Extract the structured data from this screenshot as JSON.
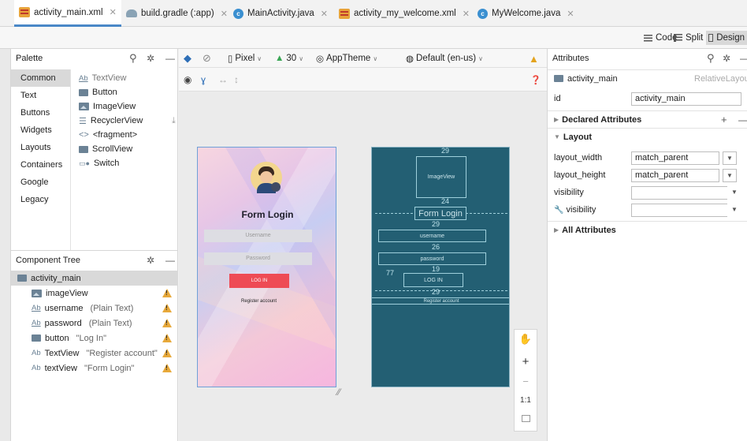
{
  "tabs": [
    {
      "label": "activity_main.xml",
      "icon": "xml-icon"
    },
    {
      "label": "build.gradle (:app)",
      "icon": "gradle-icon"
    },
    {
      "label": "MainActivity.java",
      "icon": "class-icon"
    },
    {
      "label": "activity_my_welcome.xml",
      "icon": "xml-icon"
    },
    {
      "label": "MyWelcome.java",
      "icon": "class-icon"
    }
  ],
  "modes": {
    "code": "Code",
    "split": "Split",
    "design": "Design"
  },
  "palette": {
    "title": "Palette",
    "categories": [
      "Common",
      "Text",
      "Buttons",
      "Widgets",
      "Layouts",
      "Containers",
      "Google",
      "Legacy"
    ],
    "items": [
      "TextView",
      "Button",
      "ImageView",
      "RecyclerView",
      "<fragment>",
      "ScrollView",
      "Switch"
    ]
  },
  "component_tree": {
    "title": "Component Tree",
    "root": "activity_main",
    "children": [
      {
        "name": "imageView",
        "hint": ""
      },
      {
        "name": "username",
        "hint": "(Plain Text)"
      },
      {
        "name": "password",
        "hint": "(Plain Text)"
      },
      {
        "name": "button",
        "hint": "\"Log In\""
      },
      {
        "name": "TextView",
        "hint": "\"Register account\""
      },
      {
        "name": "textView",
        "hint": "\"Form Login\""
      }
    ]
  },
  "design_toolbar": {
    "device": "Pixel",
    "api": "30",
    "theme": "AppTheme",
    "locale": "Default (en-us)"
  },
  "preview": {
    "title": "Form Login",
    "username_hint": "Username",
    "password_hint": "Password",
    "login_button": "LOG IN",
    "register": "Register account"
  },
  "blueprint": {
    "image_label": "ImageView",
    "title": "Form Login",
    "username": "username",
    "password": "password",
    "login": "LOG IN",
    "register": "Register account",
    "margins": [
      "29",
      "24",
      "29",
      "26",
      "19",
      "77",
      "29"
    ]
  },
  "zoom": {
    "fit": "1:1"
  },
  "attributes": {
    "title": "Attributes",
    "component": "activity_main",
    "component_type": "RelativeLayout",
    "id_label": "id",
    "id_value": "activity_main",
    "declared": "Declared Attributes",
    "layout_section": "Layout",
    "rows": [
      {
        "label": "layout_width",
        "value": "match_parent"
      },
      {
        "label": "layout_height",
        "value": "match_parent"
      },
      {
        "label": "visibility",
        "value": ""
      },
      {
        "label": "visibility",
        "value": ""
      }
    ],
    "all": "All Attributes"
  }
}
